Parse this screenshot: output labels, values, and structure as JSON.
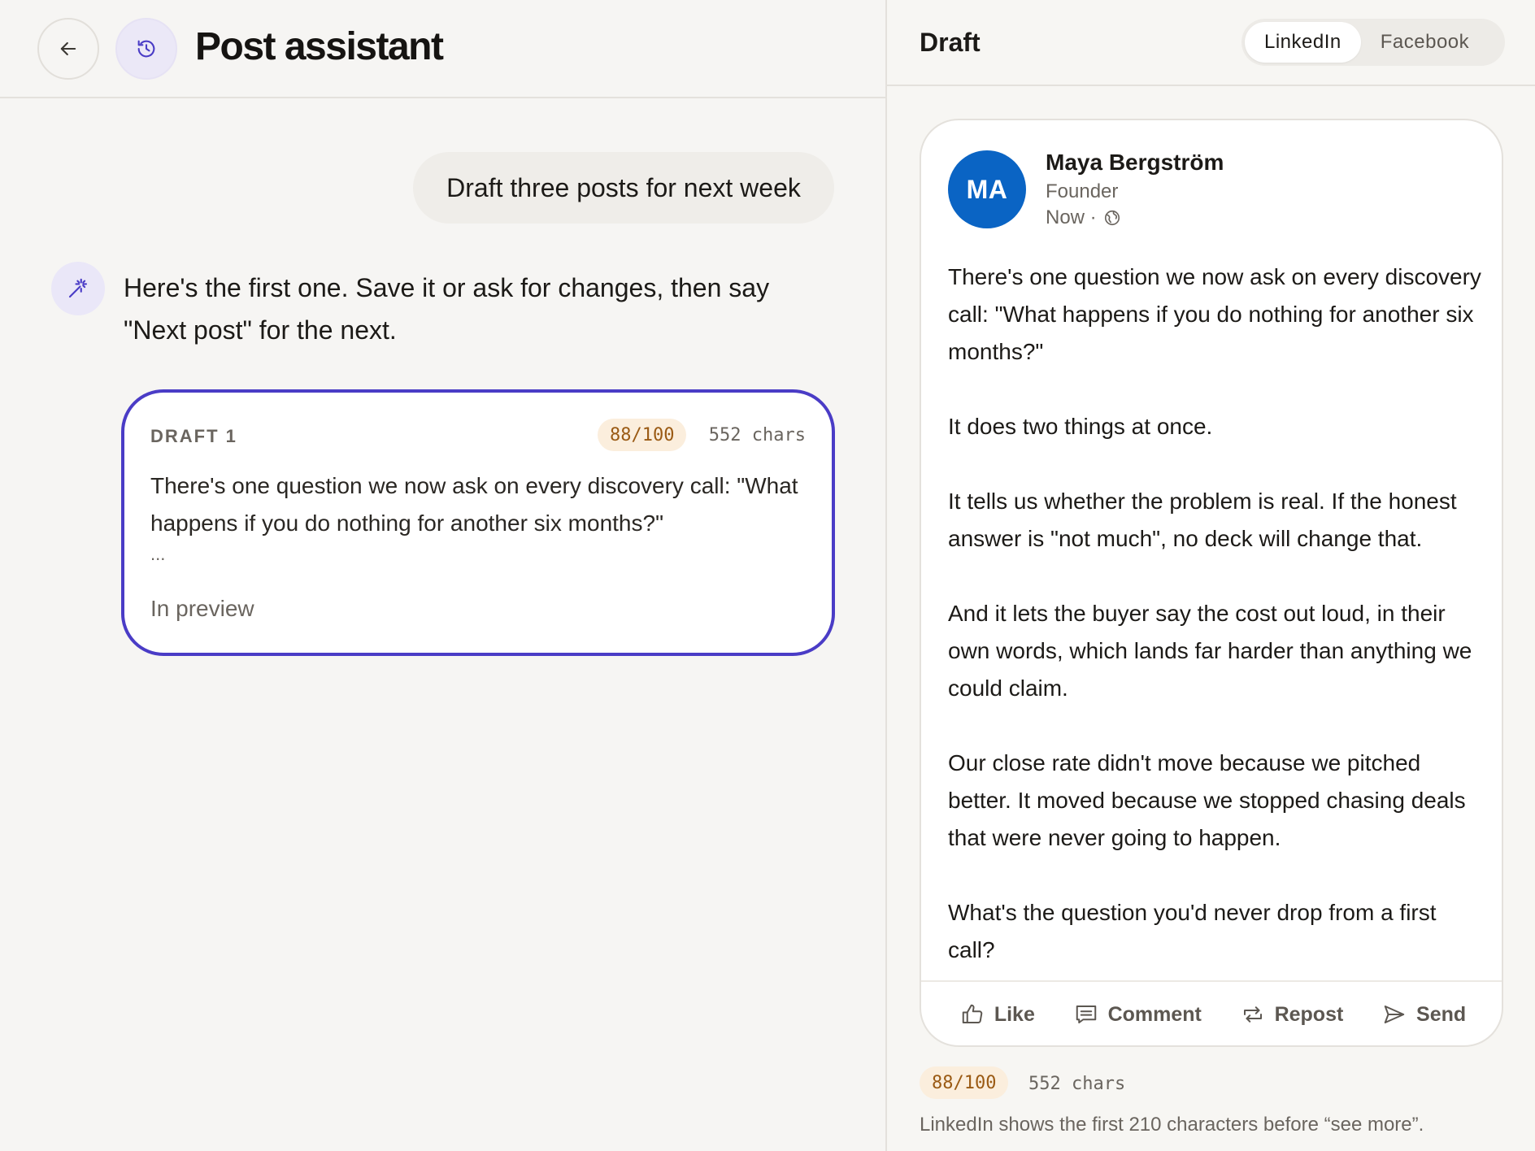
{
  "header": {
    "title": "Post assistant",
    "back_icon": "arrow-left-icon",
    "history_icon": "history-icon"
  },
  "chat": {
    "user_message": "Draft three posts for next week",
    "assistant_message": "Here's the first one. Save it or ask for changes, then say \"Next post\" for the next.",
    "assistant_icon": "magic-wand-icon"
  },
  "draft_card": {
    "label": "DRAFT 1",
    "score": "88/100",
    "chars": "552 chars",
    "text": "There's one question we now ask on every discovery call: \"What happens if you do nothing for another six months?\"",
    "ellipsis": "...",
    "status": "In preview"
  },
  "preview": {
    "title": "Draft",
    "tabs": [
      {
        "label": "LinkedIn",
        "active": true
      },
      {
        "label": "Facebook",
        "active": false
      }
    ],
    "post": {
      "avatar_initials": "MA",
      "author": "Maya Bergström",
      "role": "Founder",
      "time": "Now ·",
      "paragraphs": [
        "There's one question we now ask on every discovery call: \"What happens if you do nothing for another six months?\"",
        "It does two things at once.",
        "It tells us whether the problem is real. If the honest answer is \"not much\", no deck will change that.",
        "And it lets the buyer say the cost out loud, in their own words, which lands far harder than anything we could claim.",
        "Our close rate didn't move because we pitched better. It moved because we stopped chasing deals that were never going to happen.",
        "What's the question you'd never drop from a first call?"
      ],
      "actions": [
        {
          "label": "Like",
          "icon": "thumbs-up-icon"
        },
        {
          "label": "Comment",
          "icon": "comment-icon"
        },
        {
          "label": "Repost",
          "icon": "repost-icon"
        },
        {
          "label": "Send",
          "icon": "send-icon"
        }
      ]
    },
    "score": "88/100",
    "chars": "552 chars",
    "note": "LinkedIn shows the first 210 characters before “see more”."
  },
  "colors": {
    "accent": "#4a3cc6",
    "linkedin_blue": "#0a64c4",
    "score_bg": "#fbeedd",
    "score_text": "#9a5a14"
  }
}
